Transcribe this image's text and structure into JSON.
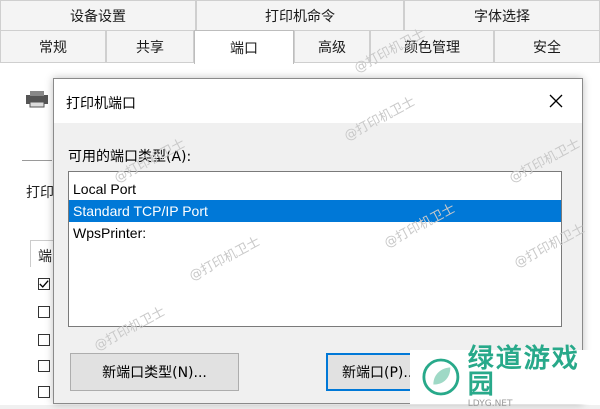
{
  "tabs_top": [
    "设备设置",
    "打印机命令",
    "字体选择"
  ],
  "tabs_bottom": [
    {
      "label": "常规",
      "active": false
    },
    {
      "label": "共享",
      "active": false
    },
    {
      "label": "端口",
      "active": true
    },
    {
      "label": "高级",
      "active": false
    },
    {
      "label": "颜色管理",
      "active": false
    },
    {
      "label": "安全",
      "active": false
    }
  ],
  "background": {
    "print_label": "打印",
    "column_header": "端"
  },
  "dialog": {
    "title": "打印机端口",
    "field_label": "可用的端口类型(A):",
    "ports": [
      {
        "label": "Local Port",
        "selected": false
      },
      {
        "label": "Standard TCP/IP Port",
        "selected": true
      },
      {
        "label": "WpsPrinter:",
        "selected": false
      }
    ],
    "new_port_type_button": "新端口类型(N)...",
    "new_port_button": "新端口(P)..."
  },
  "watermark": "@打印机卫士",
  "logo": {
    "name": "绿道游戏园",
    "sub": "LDYG.NET"
  },
  "colors": {
    "selection": "#0078d7",
    "logo_green": "#28a98a"
  }
}
